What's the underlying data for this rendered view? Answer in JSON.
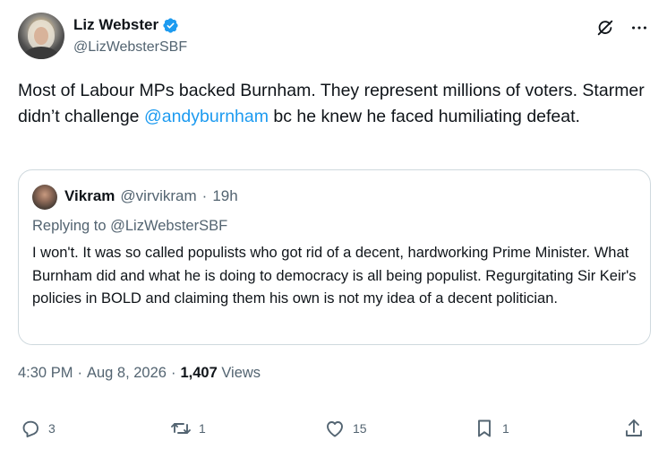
{
  "author": {
    "name": "Liz Webster",
    "handle": "@LizWebsterSBF"
  },
  "tweet": {
    "text_before": "Most of Labour MPs backed Burnham.  They represent millions of voters. Starmer didn’t challenge ",
    "mention": "@andyburnham",
    "text_after": " bc he knew he faced humiliating defeat."
  },
  "quote": {
    "name": "Vikram",
    "handle": "@virvikram",
    "separator": "·",
    "time": "19h",
    "replying_to": "Replying to @LizWebsterSBF",
    "text": "I won't. It was so called populists who got rid of a decent, hardworking Prime Minister.  What Burnham did and what he is doing to democracy is all being populist.  Regurgitating Sir Keir's policies in BOLD and claiming them his own is not my idea of a decent politician."
  },
  "meta": {
    "time": "4:30 PM",
    "sep1": "·",
    "date": "Aug 8, 2026",
    "sep2": "·",
    "views_count": "1,407",
    "views_label": "Views"
  },
  "actions": {
    "replies": "3",
    "reposts": "1",
    "likes": "15",
    "bookmarks": "1"
  },
  "colors": {
    "link": "#1d9bf0",
    "secondary_text": "#536471",
    "border": "#cfd9de"
  },
  "icons": [
    "verified-badge-icon",
    "grok-icon",
    "more-icon",
    "reply-icon",
    "repost-icon",
    "like-icon",
    "bookmark-icon",
    "share-icon"
  ]
}
